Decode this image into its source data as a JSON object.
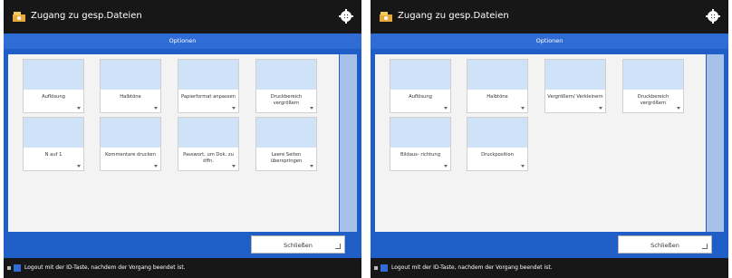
{
  "left": {
    "title": "Zugang zu gesp.Dateien",
    "options_tab": "Optionen",
    "close_button": "Schließen",
    "status": "Logout mit der ID-Taste, nachdem der Vorgang beendet ist.",
    "tiles": [
      {
        "label": "Auflösung",
        "icon": "resolution-icon"
      },
      {
        "label": "Halbtöne",
        "icon": "halftones-icon"
      },
      {
        "label": "Papierformat anpassen",
        "icon": "paper-size-icon"
      },
      {
        "label": "Druckbereich vergrößern",
        "icon": "enlarge-print-area-icon"
      },
      {
        "label": "N auf 1",
        "icon": "n-on-1-icon"
      },
      {
        "label": "Kommentare drucken",
        "icon": "print-comments-icon"
      },
      {
        "label": "Passwort, um Dok. zu öffn.",
        "icon": "password-document-icon"
      },
      {
        "label": "Leere Seiten überspringen",
        "icon": "skip-blank-pages-icon"
      }
    ]
  },
  "right": {
    "title": "Zugang zu gesp.Dateien",
    "options_tab": "Optionen",
    "close_button": "Schließen",
    "status": "Logout mit der ID-Taste, nachdem der Vorgang beendet ist.",
    "tiles": [
      {
        "label": "Auflösung",
        "icon": "resolution-icon"
      },
      {
        "label": "Halbtöne",
        "icon": "halftones-icon"
      },
      {
        "label": "Vergrößern/ Verkleinern",
        "icon": "zoom-icon"
      },
      {
        "label": "Druckbereich vergrößern",
        "icon": "enlarge-print-area-icon"
      },
      {
        "label": "Bildaus- richtung",
        "icon": "image-orientation-icon"
      },
      {
        "label": "Druckposition",
        "icon": "print-position-icon"
      }
    ]
  },
  "colors": {
    "topbar": "#171717",
    "options_bar": "#2f6cd6",
    "panel": "#1e5ec6",
    "scrollbar": "#a8c1e9",
    "tile_icon_bg": "#cfe2f7"
  }
}
